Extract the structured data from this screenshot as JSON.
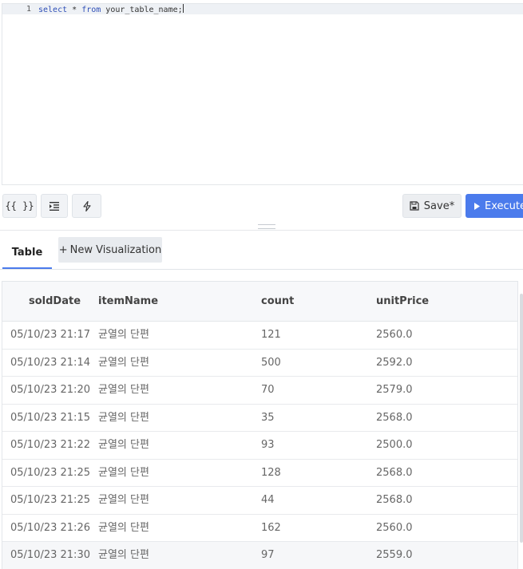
{
  "editor": {
    "line_number": "1",
    "keyword_select": "select",
    "star": " * ",
    "keyword_from": "from",
    "table_ref": " your_table_name;"
  },
  "toolbar": {
    "format_label": "{{ }}",
    "save_label": "Save*",
    "execute_label": "Execute"
  },
  "tabs": {
    "table_label": "Table",
    "new_vis_plus": "+",
    "new_vis_label": "New Visualization"
  },
  "table": {
    "columns": [
      "soldDate",
      "itemName",
      "count",
      "unitPrice"
    ],
    "rows": [
      [
        "05/10/23 21:17",
        "균열의 단편",
        "121",
        "2560.0"
      ],
      [
        "05/10/23 21:14",
        "균열의 단편",
        "500",
        "2592.0"
      ],
      [
        "05/10/23 21:20",
        "균열의 단편",
        "70",
        "2579.0"
      ],
      [
        "05/10/23 21:15",
        "균열의 단편",
        "35",
        "2568.0"
      ],
      [
        "05/10/23 21:22",
        "균열의 단편",
        "93",
        "2500.0"
      ],
      [
        "05/10/23 21:25",
        "균열의 단편",
        "128",
        "2568.0"
      ],
      [
        "05/10/23 21:25",
        "균열의 단편",
        "44",
        "2568.0"
      ],
      [
        "05/10/23 21:26",
        "균열의 단편",
        "162",
        "2560.0"
      ],
      [
        "05/10/23 21:30",
        "균열의 단편",
        "97",
        "2559.0"
      ]
    ]
  },
  "colors": {
    "accent": "#4b7bec",
    "keyword": "#2f4fb7"
  }
}
